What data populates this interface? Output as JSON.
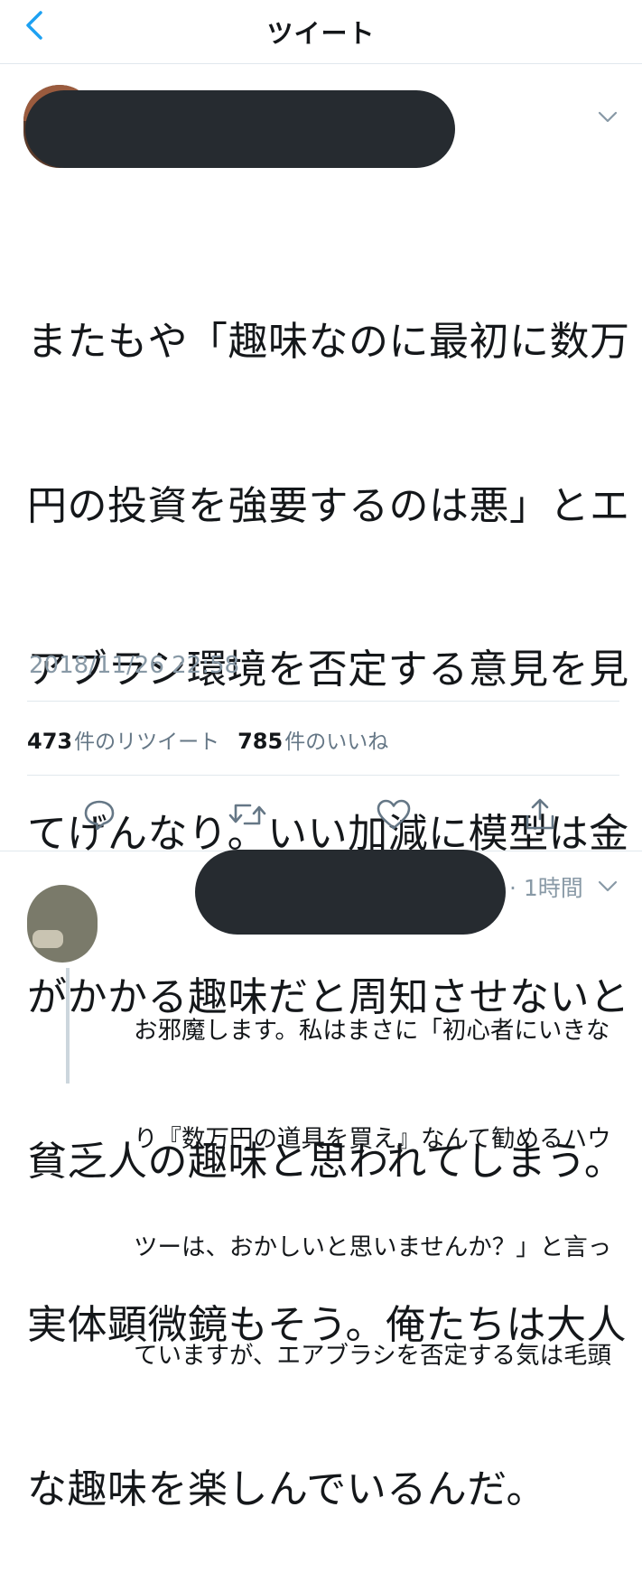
{
  "header": {
    "title": "ツイート"
  },
  "tweet": {
    "lines": [
      "またもや「趣味なのに最初に数万",
      "円の投資を強要するのは悪」とエ",
      "アブラシ環境を否定する意見を見",
      "てげんなり。いい加減に模型は金",
      "がかかる趣味だと周知させないと",
      "貧乏人の趣味と思われてしまう。",
      "実体顕微鏡もそう。俺たちは大人",
      "な趣味を楽しんでいるんだ。"
    ],
    "timestamp": "2018/11/26 22:58",
    "retweet_count": "473",
    "retweet_label": "件のリツイート",
    "like_count": "785",
    "like_label": "件のいいね"
  },
  "actions": {
    "icons": [
      "reply-icon",
      "retweet-icon",
      "like-icon",
      "share-icon"
    ]
  },
  "reply": {
    "time": "· 1時間",
    "lines": [
      "お邪魔します。私はまさに「初心者にいきな",
      "り『数万円の道具を買え』なんて勧めるハウ",
      "ツーは、おかしいと思いませんか？」と言っ",
      "ていますが、エアブラシを否定する気は毛頭"
    ]
  },
  "colors": {
    "accent": "#1da1f2",
    "icon_gray": "#657786",
    "redaction": "#262b30"
  }
}
